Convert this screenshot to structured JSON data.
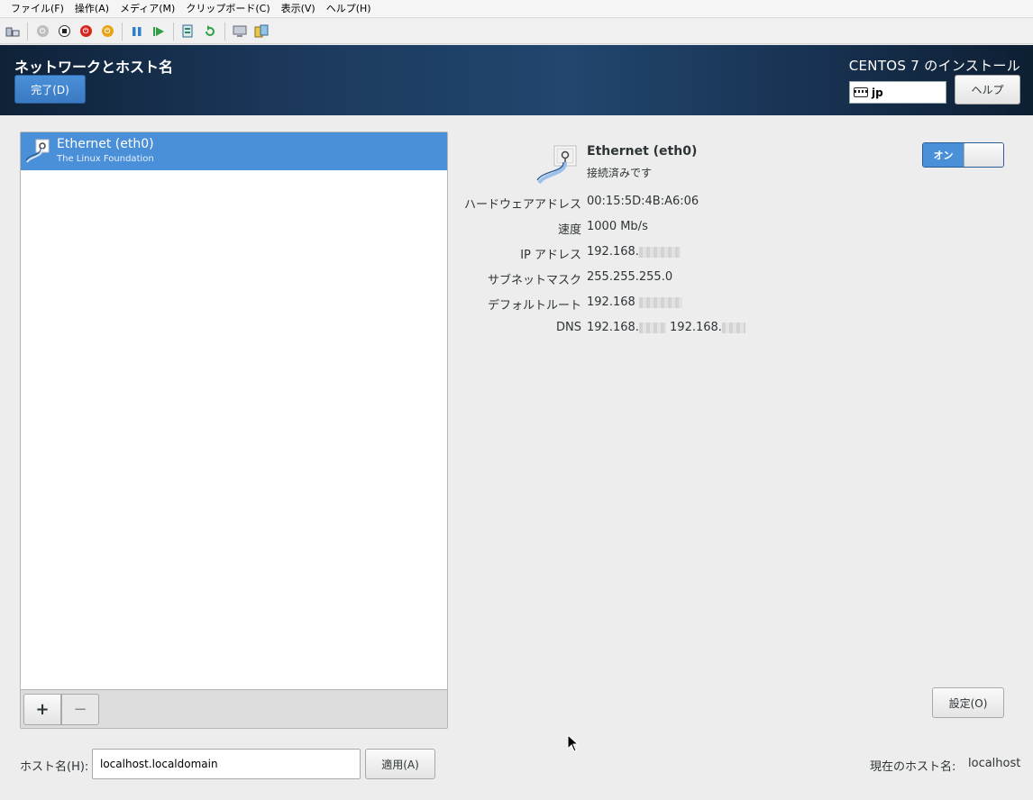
{
  "menubar": {
    "items": [
      "ファイル(F)",
      "操作(A)",
      "メディア(M)",
      "クリップボード(C)",
      "表示(V)",
      "ヘルプ(H)"
    ]
  },
  "toolbar": {
    "icons": [
      "ctrl-alt-del-icon",
      "start-icon",
      "turn-off-icon",
      "shut-down-icon",
      "save-icon",
      "pause-icon",
      "reset-icon",
      "checkpoint-icon",
      "revert-icon",
      "enhanced-session-icon",
      "share-icon"
    ]
  },
  "header": {
    "title": "ネットワークとホスト名",
    "done_label": "完了(D)",
    "product_title": "CENTOS 7 のインストール",
    "keyboard_layout": "jp",
    "help_label": "ヘルプ"
  },
  "device_list": {
    "items": [
      {
        "name": "Ethernet (eth0)",
        "vendor": "The Linux Foundation"
      }
    ],
    "add_label": "+",
    "remove_label": "−"
  },
  "details": {
    "name": "Ethernet (eth0)",
    "status": "接続済みです",
    "toggle_label": "オン",
    "properties": [
      {
        "label": "ハードウェアアドレス",
        "value": "00:15:5D:4B:A6:06"
      },
      {
        "label": "速度",
        "value": "1000 Mb/s"
      },
      {
        "label": "IP アドレス",
        "value": "192.168."
      },
      {
        "label": "サブネットマスク",
        "value": "255.255.255.0"
      },
      {
        "label": "デフォルトルート",
        "value": "192.168"
      },
      {
        "label": "DNS",
        "value": "192.168.",
        "value2": "192.168."
      }
    ],
    "settings_label": "設定(O)"
  },
  "hostname": {
    "label": "ホスト名(H):",
    "value": "localhost.localdomain",
    "apply_label": "適用(A)",
    "current_label": "現在のホスト名:",
    "current_value": "localhost"
  },
  "colors": {
    "accent": "#4a90d9",
    "header_dark": "#0f2238"
  }
}
